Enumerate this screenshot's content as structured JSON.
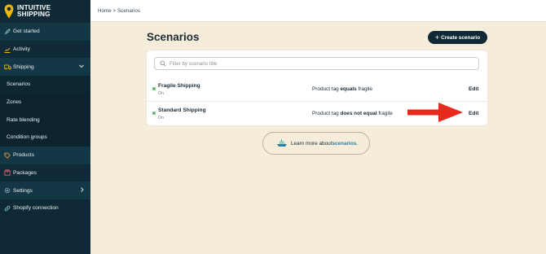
{
  "brand": {
    "line1": "INTUITIVE",
    "line2": "SHIPPING"
  },
  "nav": {
    "get_started": "Get started",
    "activity": "Activity",
    "shipping": "Shipping",
    "scenarios": "Scenarios",
    "zones": "Zones",
    "rate_blending": "Rate blending",
    "condition_groups": "Condition groups",
    "products": "Products",
    "packages": "Packages",
    "settings": "Settings",
    "shopify_connection": "Shopify connection"
  },
  "breadcrumb": "Home > Scenarios",
  "page": {
    "title": "Scenarios",
    "create_button": "Create scenario",
    "filter_placeholder": "Filter by scenario title"
  },
  "scenarios": [
    {
      "name": "Fragile Shipping",
      "status": "On",
      "cond_prefix": "Product tag ",
      "cond_op": "equals",
      "cond_value": " fragile",
      "edit": "Edit"
    },
    {
      "name": "Standard Shipping",
      "status": "On",
      "cond_prefix": "Product tag ",
      "cond_op": "does not equal",
      "cond_value": " fragile",
      "edit": "Edit"
    }
  ],
  "learn": {
    "text": "Learn more about ",
    "link": "scenarios."
  },
  "colors": {
    "sidebar": "#0f2a36",
    "background": "#f5ecd9",
    "accent_link": "#2b7fa6",
    "status_on": "#6fb46f",
    "arrow": "#e8291c",
    "brand_yellow": "#f2b705"
  },
  "icons": [
    "map-pin-logo",
    "rocket-icon",
    "chart-icon",
    "truck-icon",
    "chevron-down-icon",
    "tag-icon",
    "box-icon",
    "gear-icon",
    "chevron-right-icon",
    "link-icon",
    "search-icon",
    "plus-icon",
    "ship-icon",
    "red-arrow"
  ]
}
